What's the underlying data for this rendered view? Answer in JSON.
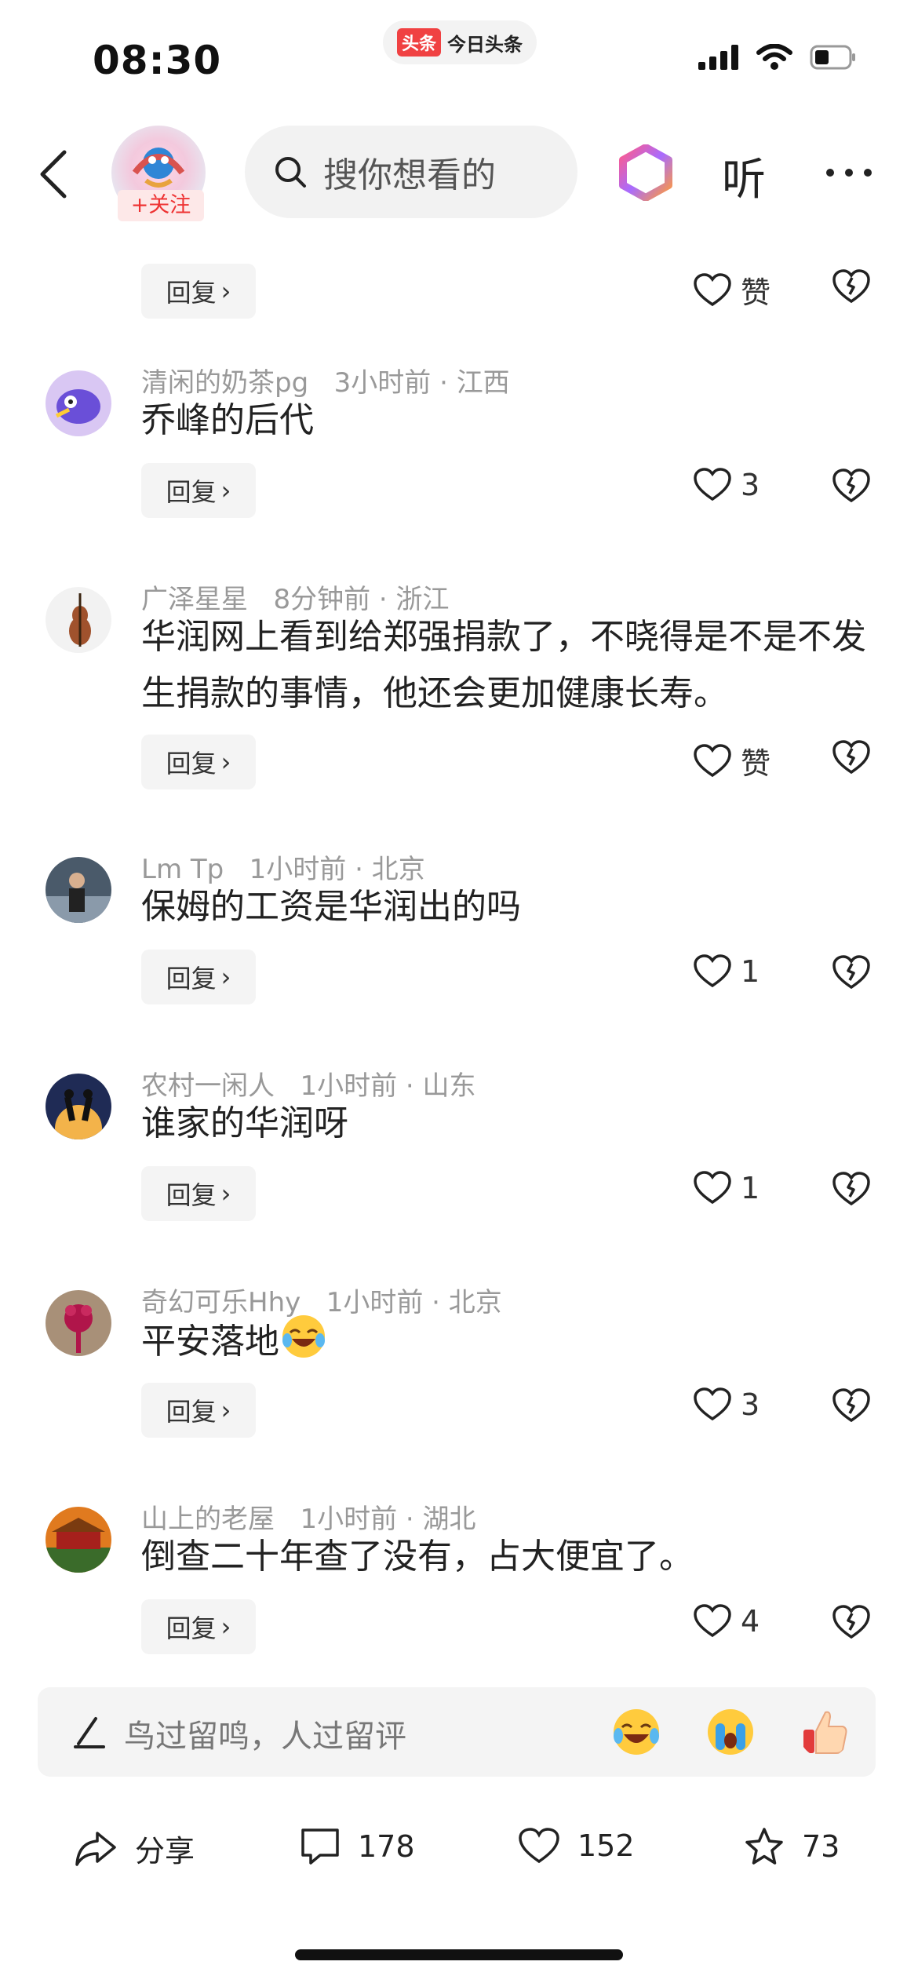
{
  "status_bar": {
    "time": "08:30",
    "app_name": "今日头条",
    "app_logo_text": "头条",
    "icons": [
      "signal-icon",
      "wifi-icon",
      "battery-icon"
    ]
  },
  "header": {
    "follow_label": "+关注",
    "search_placeholder": "搜你想看的",
    "listen_label": "听",
    "icons": [
      "back-icon",
      "search-icon",
      "ai-assistant-icon",
      "more-icon"
    ]
  },
  "top_partial_comment": {
    "reply_label": "回复",
    "like_label": "赞"
  },
  "comments": [
    {
      "user": "清闲的奶茶pg",
      "time": "3小时前",
      "location": "江西",
      "text": "乔峰的后代",
      "likes": "3"
    },
    {
      "user": "广泽星星",
      "time": "8分钟前",
      "location": "浙江",
      "text": "华润网上看到给郑强捐款了，不晓得是不是不发生捐款的事情，他还会更加健康长寿。",
      "likes": "赞"
    },
    {
      "user": "Lm Tp",
      "time": "1小时前",
      "location": "北京",
      "text": "保姆的工资是华润出的吗",
      "likes": "1"
    },
    {
      "user": "农村一闲人",
      "time": "1小时前",
      "location": "山东",
      "text": "谁家的华润呀",
      "likes": "1"
    },
    {
      "user": "奇幻可乐Hhy",
      "time": "1小时前",
      "location": "北京",
      "text": "平安落地",
      "likes": "3"
    },
    {
      "user": "山上的老屋",
      "time": "1小时前",
      "location": "湖北",
      "text": "倒查二十年查了没有，占大便宜了。",
      "likes": "4"
    }
  ],
  "reply_label": "回复",
  "meta_separator": "·",
  "input_bar": {
    "placeholder": "鸟过留鸣，人过留评",
    "emojis": [
      "laugh-cry-emoji",
      "crying-emoji",
      "thumbs-up-emoji"
    ]
  },
  "bottom_actions": {
    "share_label": "分享",
    "comments_count": "178",
    "likes_count": "152",
    "favorites_count": "73"
  },
  "colors": {
    "accent_red": "#f04142",
    "meta_gray": "#999999",
    "pill_bg": "#f4f4f4"
  }
}
